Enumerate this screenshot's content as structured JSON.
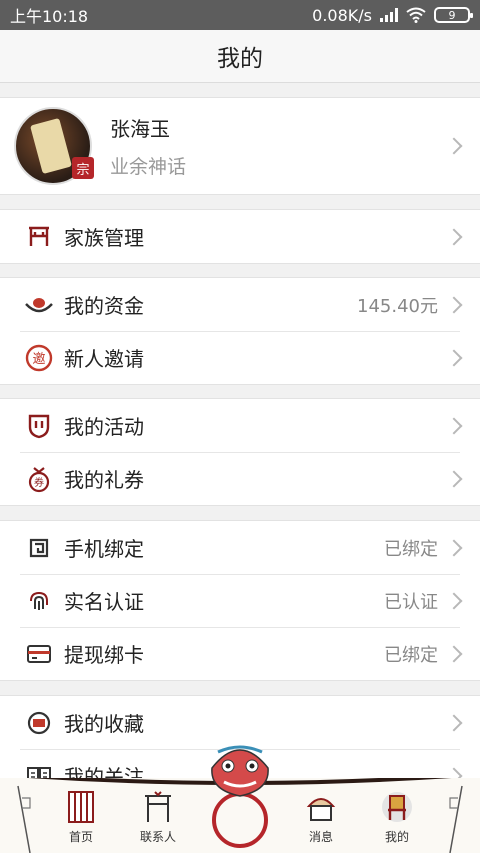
{
  "status_bar": {
    "time": "上午10:18",
    "speed": "0.08K/s",
    "battery": "9"
  },
  "title": "我的",
  "profile": {
    "name": "张海玉",
    "subtitle": "业余神话",
    "badge": "宗"
  },
  "sections": [
    {
      "items": [
        {
          "label": "家族管理",
          "value": "",
          "icon": "family-gate-icon"
        }
      ]
    },
    {
      "items": [
        {
          "label": "我的资金",
          "value": "145.40元",
          "icon": "gold-ingot-icon"
        },
        {
          "label": "新人邀请",
          "value": "",
          "icon": "invite-icon"
        }
      ]
    },
    {
      "items": [
        {
          "label": "我的活动",
          "value": "",
          "icon": "activity-shield-icon"
        },
        {
          "label": "我的礼券",
          "value": "",
          "icon": "coupon-bag-icon"
        }
      ]
    },
    {
      "items": [
        {
          "label": "手机绑定",
          "value": "已绑定",
          "icon": "phone-bind-icon"
        },
        {
          "label": "实名认证",
          "value": "已认证",
          "icon": "fingerprint-icon"
        },
        {
          "label": "提现绑卡",
          "value": "已绑定",
          "icon": "bank-card-icon"
        }
      ]
    },
    {
      "items": [
        {
          "label": "我的收藏",
          "value": "",
          "icon": "collection-icon"
        },
        {
          "label": "我的关注",
          "value": "",
          "icon": "book-icon"
        }
      ]
    }
  ],
  "bottom_nav": [
    {
      "label": "首页",
      "icon": "home-scroll-icon"
    },
    {
      "label": "联系人",
      "icon": "contacts-gate-icon"
    },
    {
      "label": "",
      "icon": "lion-knocker-icon"
    },
    {
      "label": "消息",
      "icon": "message-tent-icon"
    },
    {
      "label": "我的",
      "icon": "mine-chair-icon"
    }
  ],
  "colors": {
    "accent": "#b5262a",
    "status_bar": "#5d5d5d"
  }
}
